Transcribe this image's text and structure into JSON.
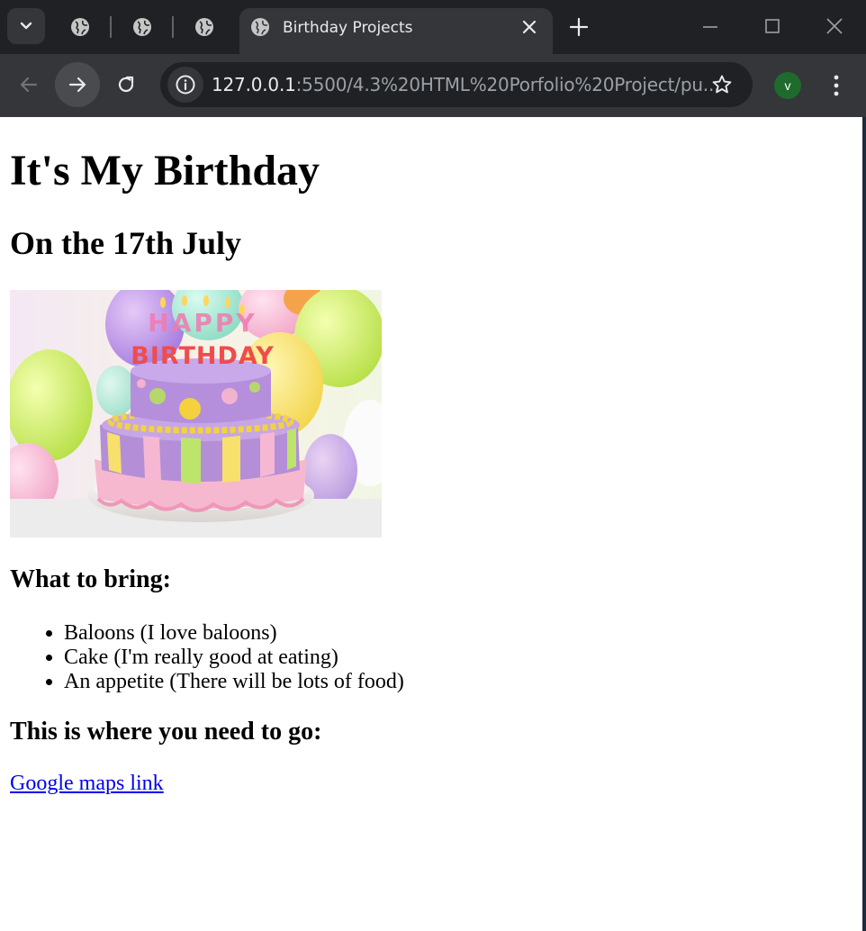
{
  "browser": {
    "active_tab_title": "Birthday Projects",
    "url_host": "127.0.0.1",
    "url_rest": ":5500/4.3%20HTML%20Porfolio%20Project/pu...",
    "profile_initial": "v"
  },
  "page": {
    "title": "It's My Birthday",
    "subtitle": "On the 17th July",
    "cake_text_top": "HAPPY",
    "cake_text_bottom": "BIRTHDAY",
    "bring_heading": "What to bring:",
    "bring_items": [
      "Baloons (I love baloons)",
      "Cake (I'm really good at eating)",
      "An appetite (There will be lots of food)"
    ],
    "go_heading": "This is where you need to go:",
    "maps_link": "Google maps link"
  },
  "colors": {
    "chrome_dark": "#202124",
    "chrome_toolbar": "#35363a",
    "link": "#0000ee",
    "profile": "#1e6b2d"
  }
}
